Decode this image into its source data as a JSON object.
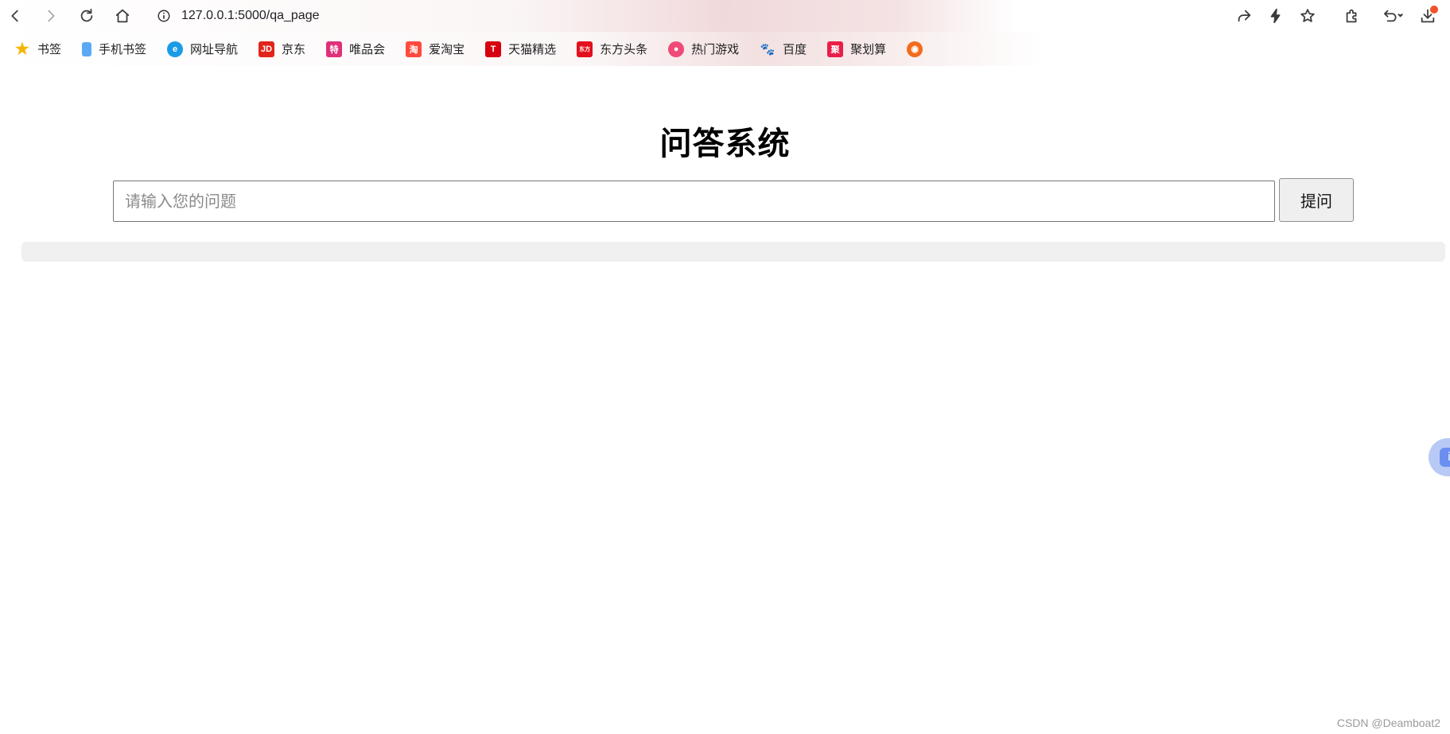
{
  "browser": {
    "url": "127.0.0.1:5000/qa_page"
  },
  "bookmarks": [
    {
      "label": "书签",
      "icon": "star-icon",
      "color": "#f5b400",
      "glyph": "★"
    },
    {
      "label": "手机书签",
      "icon": "phone-icon",
      "color": "#5aa9f5",
      "glyph": ""
    },
    {
      "label": "网址导航",
      "icon": "e-browser-icon",
      "color": "#1a9be8",
      "glyph": "e"
    },
    {
      "label": "京东",
      "icon": "jd-icon",
      "color": "#e1251b",
      "glyph": "JD"
    },
    {
      "label": "唯品会",
      "icon": "vip-icon",
      "color": "#e0307a",
      "glyph": "特"
    },
    {
      "label": "爱淘宝",
      "icon": "taobao-icon",
      "color": "#ff4a3d",
      "glyph": "淘"
    },
    {
      "label": "天猫精选",
      "icon": "tmall-icon",
      "color": "#d6000f",
      "glyph": "T"
    },
    {
      "label": "东方头条",
      "icon": "eastday-icon",
      "color": "#e3101b",
      "glyph": "东方"
    },
    {
      "label": "热门游戏",
      "icon": "game-icon",
      "color": "#f04a78",
      "glyph": "●"
    },
    {
      "label": "百度",
      "icon": "baidu-paw-icon",
      "color": "#2b32e1",
      "glyph": "🐾"
    },
    {
      "label": "聚划算",
      "icon": "juhuasuan-icon",
      "color": "#e91e47",
      "glyph": "聚"
    },
    {
      "label": "",
      "icon": "owl-icon",
      "color": "#f36b1c",
      "glyph": "◉"
    }
  ],
  "page": {
    "title": "问答系统",
    "input_placeholder": "请输入您的问题",
    "input_value": "",
    "ask_button_label": "提问",
    "answer_text": ""
  },
  "side_float_glyph": "i",
  "watermark": "CSDN @Deamboat2"
}
